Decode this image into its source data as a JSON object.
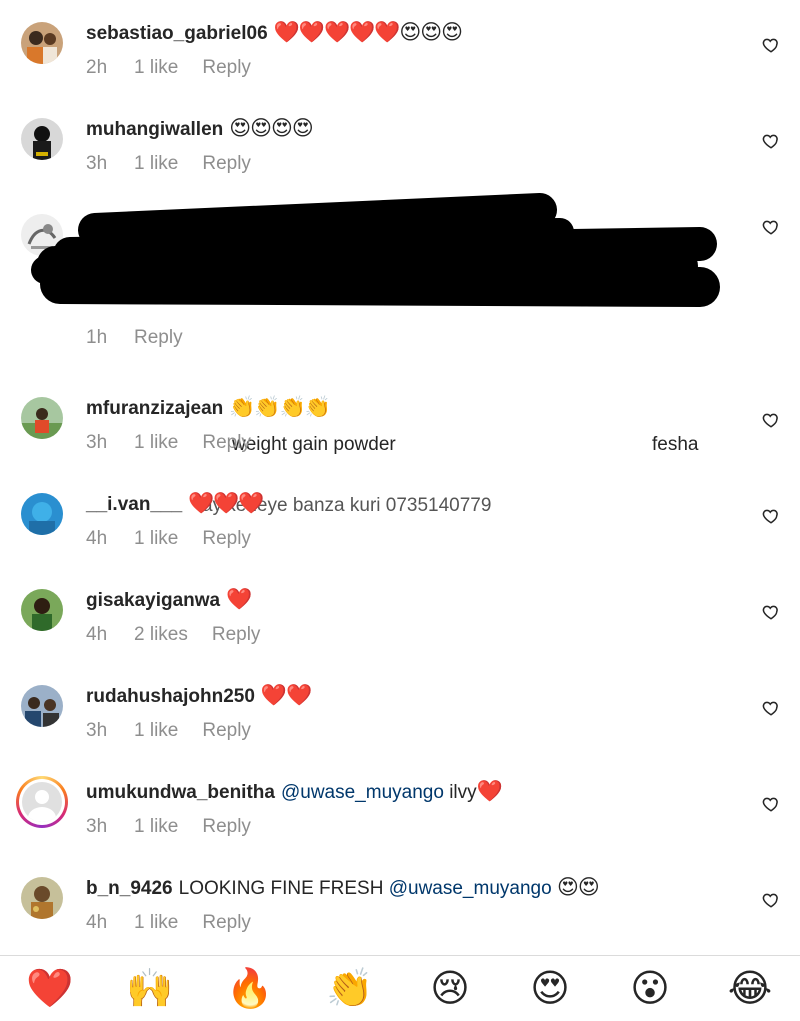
{
  "comments": [
    {
      "username": "sebastiao_gabriel06",
      "mention": "",
      "text": "",
      "emoji": "❤️❤️❤️❤️❤️😍😍😍",
      "time": "2h",
      "likes": "1 like",
      "reply": "Reply"
    },
    {
      "username": "muhangiwallen",
      "mention": "",
      "text": "",
      "emoji": "😍😍😍😍",
      "time": "3h",
      "likes": "1 like",
      "reply": "Reply"
    },
    {
      "username": "",
      "mention": "",
      "text": "",
      "emoji": "",
      "time": "1h",
      "likes": "",
      "reply": "Reply",
      "censored_fragments": [
        "weight gain powder",
        "fesha",
        "ayikeneye banza kuri 0735140779"
      ]
    },
    {
      "username": "mfuranzizajean",
      "mention": "",
      "text": "",
      "emoji": "👏👏👏👏",
      "time": "3h",
      "likes": "1 like",
      "reply": "Reply"
    },
    {
      "username": "__i.van___",
      "mention": "",
      "text": "",
      "emoji": "❤️❤️❤️",
      "time": "4h",
      "likes": "1 like",
      "reply": "Reply"
    },
    {
      "username": "gisakayiganwa",
      "mention": "",
      "text": "",
      "emoji": "❤️",
      "time": "4h",
      "likes": "2 likes",
      "reply": "Reply"
    },
    {
      "username": "rudahushajohn250",
      "mention": "",
      "text": "",
      "emoji": "❤️❤️",
      "time": "3h",
      "likes": "1 like",
      "reply": "Reply"
    },
    {
      "username": "umukundwa_benitha",
      "mention": "@uwase_muyango",
      "text": "ilvy",
      "emoji": "❤️",
      "time": "3h",
      "likes": "1 like",
      "reply": "Reply"
    },
    {
      "username": "b_n_9426",
      "mention": "@uwase_muyango",
      "text": "LOOKING FINE FRESH",
      "emoji": "😍😍",
      "time": "4h",
      "likes": "1 like",
      "reply": "Reply"
    }
  ],
  "reactions": [
    "❤️",
    "🙌",
    "🔥",
    "👏",
    "😢",
    "😍",
    "😮",
    "😂"
  ],
  "colors": {
    "text": "#262626",
    "meta": "#8e8e8e",
    "mention": "#00376b",
    "divider": "#dbdbdb"
  },
  "icons": {
    "like": "heart-outline-icon",
    "avatar_placeholder": "default-avatar-icon"
  }
}
